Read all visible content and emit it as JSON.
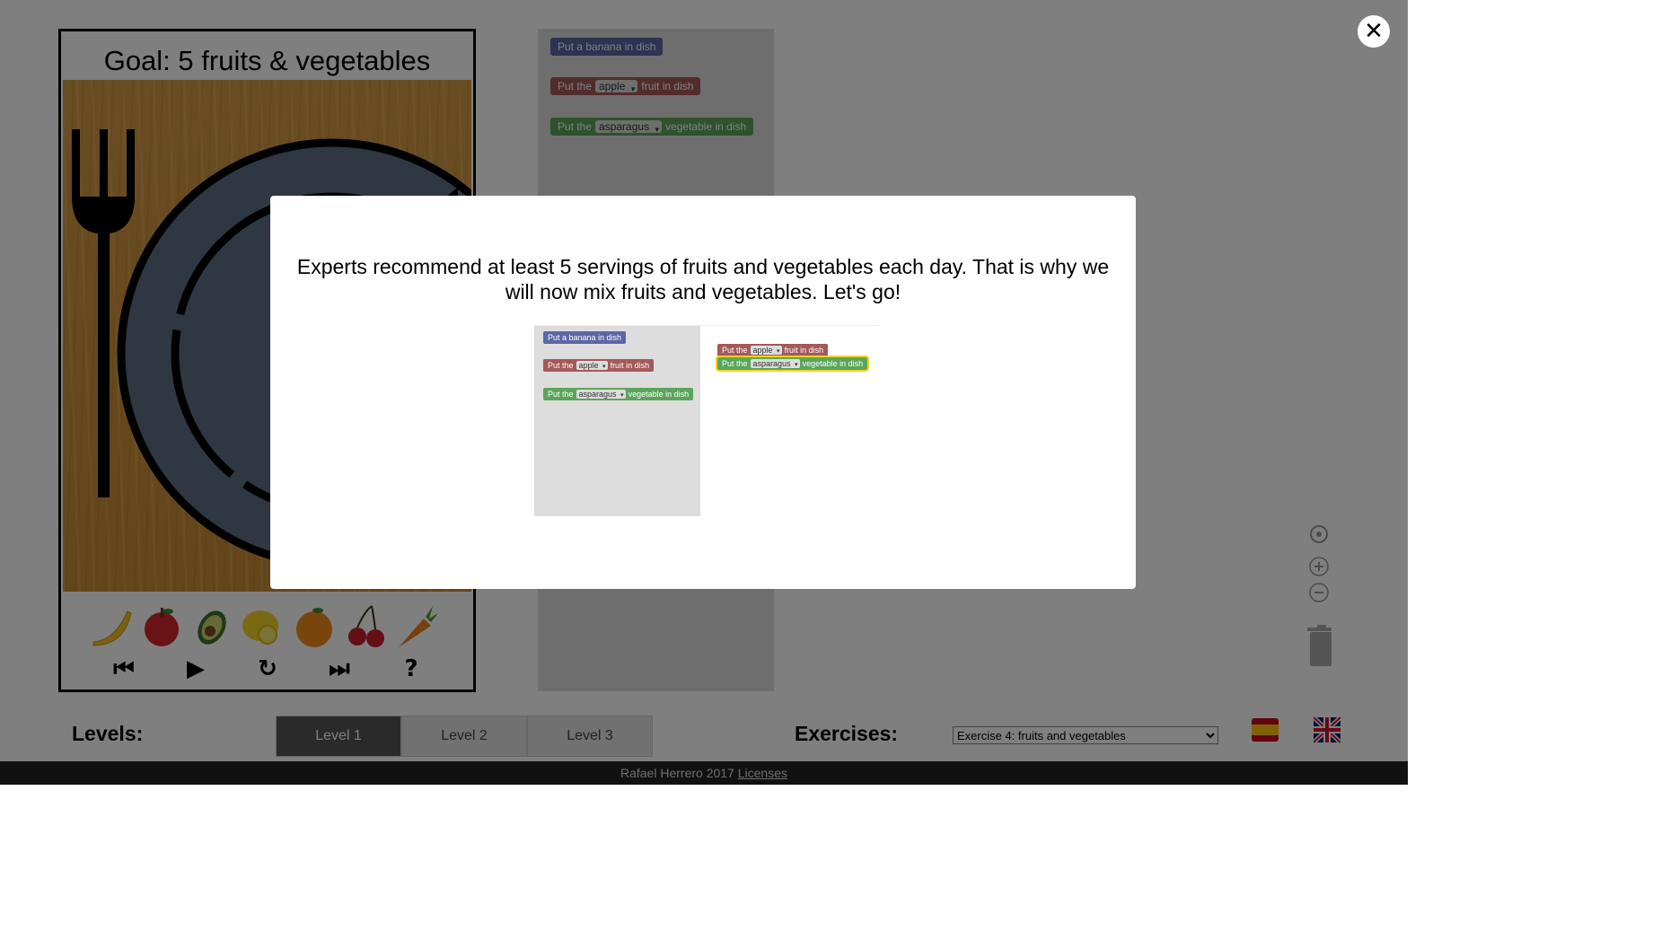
{
  "game": {
    "goal": "Goal: 5 fruits & vegetables",
    "fruits": [
      "banana-icon",
      "apple-icon",
      "avocado-icon",
      "lemon-icon",
      "orange-icon",
      "cherry-icon",
      "carrot-icon"
    ],
    "controls": {
      "first": "⏮",
      "play": "▶",
      "reset": "↻",
      "last": "⏭",
      "help": "?"
    }
  },
  "toolbox": {
    "banana_block": "Put a banana in dish",
    "apple_block": {
      "prefix": "Put the",
      "option": "apple",
      "suffix": "fruit in dish"
    },
    "veg_block": {
      "prefix": "Put the",
      "option": "asparagus",
      "suffix": "vegetable in dish"
    }
  },
  "modal": {
    "text": "Experts recommend at least 5 servings of fruits and vegetables each day. That is why we will now mix fruits and vegetables. Let's go!",
    "preview": {
      "banana_block": "Put a banana in dish",
      "apple_block": {
        "prefix": "Put the",
        "option": "apple",
        "suffix": "fruit in dish"
      },
      "veg_block": {
        "prefix": "Put the",
        "option": "asparagus",
        "suffix": "vegetable in dish"
      }
    }
  },
  "bottom": {
    "levels_label": "Levels:",
    "levels": [
      "Level 1",
      "Level 2",
      "Level 3"
    ],
    "active_level": "Level 1",
    "exercises_label": "Exercises:",
    "exercise_selected": "Exercise 4: fruits and vegetables"
  },
  "footer": {
    "text": "Rafael Herrero 2017",
    "link": "Licenses"
  },
  "colors": {
    "block_blue": "#5b67a5",
    "block_red": "#a5585a",
    "block_green": "#5ba55b",
    "plate": "#5d6f84"
  }
}
